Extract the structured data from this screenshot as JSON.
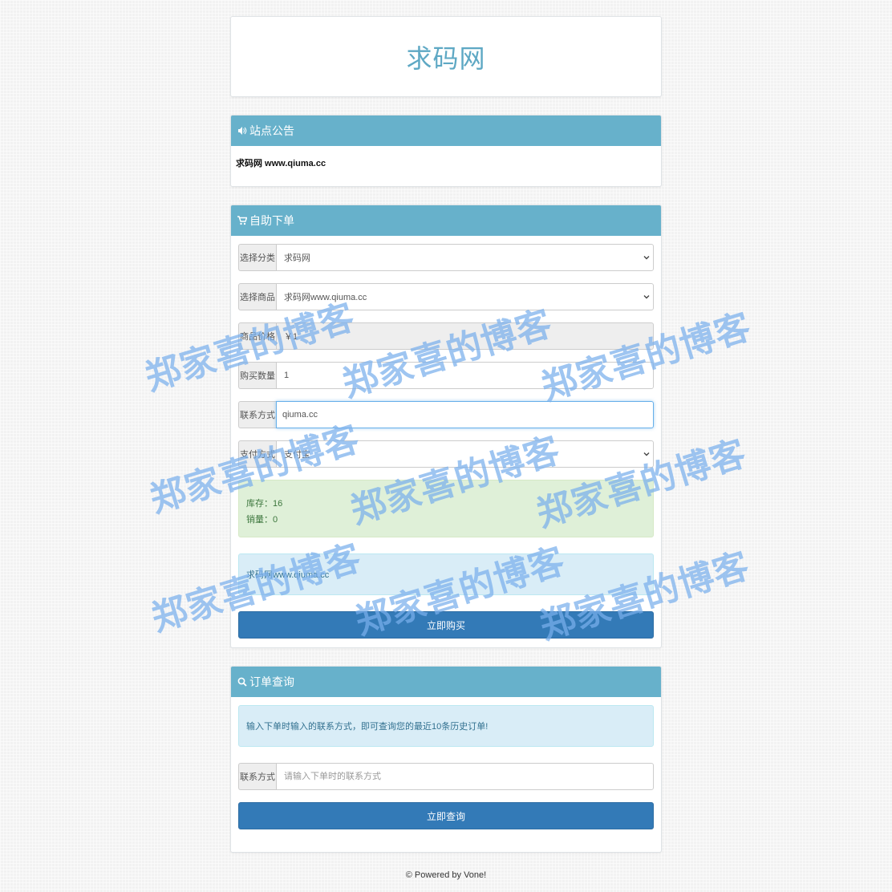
{
  "site": {
    "title": "求码网"
  },
  "notice": {
    "heading": "站点公告",
    "text": "求码网 www.qiuma.cc"
  },
  "order": {
    "heading": "自助下单",
    "category": {
      "label": "选择分类",
      "value": "求码网"
    },
    "product": {
      "label": "选择商品",
      "value": "求码网www.qiuma.cc"
    },
    "price": {
      "label": "商品价格",
      "value": "￥1"
    },
    "quantity": {
      "label": "购买数量",
      "value": "1"
    },
    "contact": {
      "label": "联系方式",
      "value": "qiuma.cc"
    },
    "payment": {
      "label": "支付方式",
      "value": "支付宝"
    },
    "stock_text": "库存：16",
    "sales_text": "销量：0",
    "info_text": "求码网www.qiuma.cc",
    "buy_button": "立即购买"
  },
  "query": {
    "heading": "订单查询",
    "info_text": "输入下单时输入的联系方式，即可查询您的最近10条历史订单!",
    "contact": {
      "label": "联系方式",
      "placeholder": "请输入下单时的联系方式"
    },
    "query_button": "立即查询"
  },
  "footer": {
    "text": "© Powered by Vone!"
  },
  "watermark": {
    "text": "郑家喜的博客"
  },
  "colors": {
    "panel_heading": "#67b1cb",
    "primary_button": "#337ab7",
    "site_title": "#5ea8c4",
    "success_alert": "#dff0d8",
    "info_alert": "#d9edf7"
  }
}
